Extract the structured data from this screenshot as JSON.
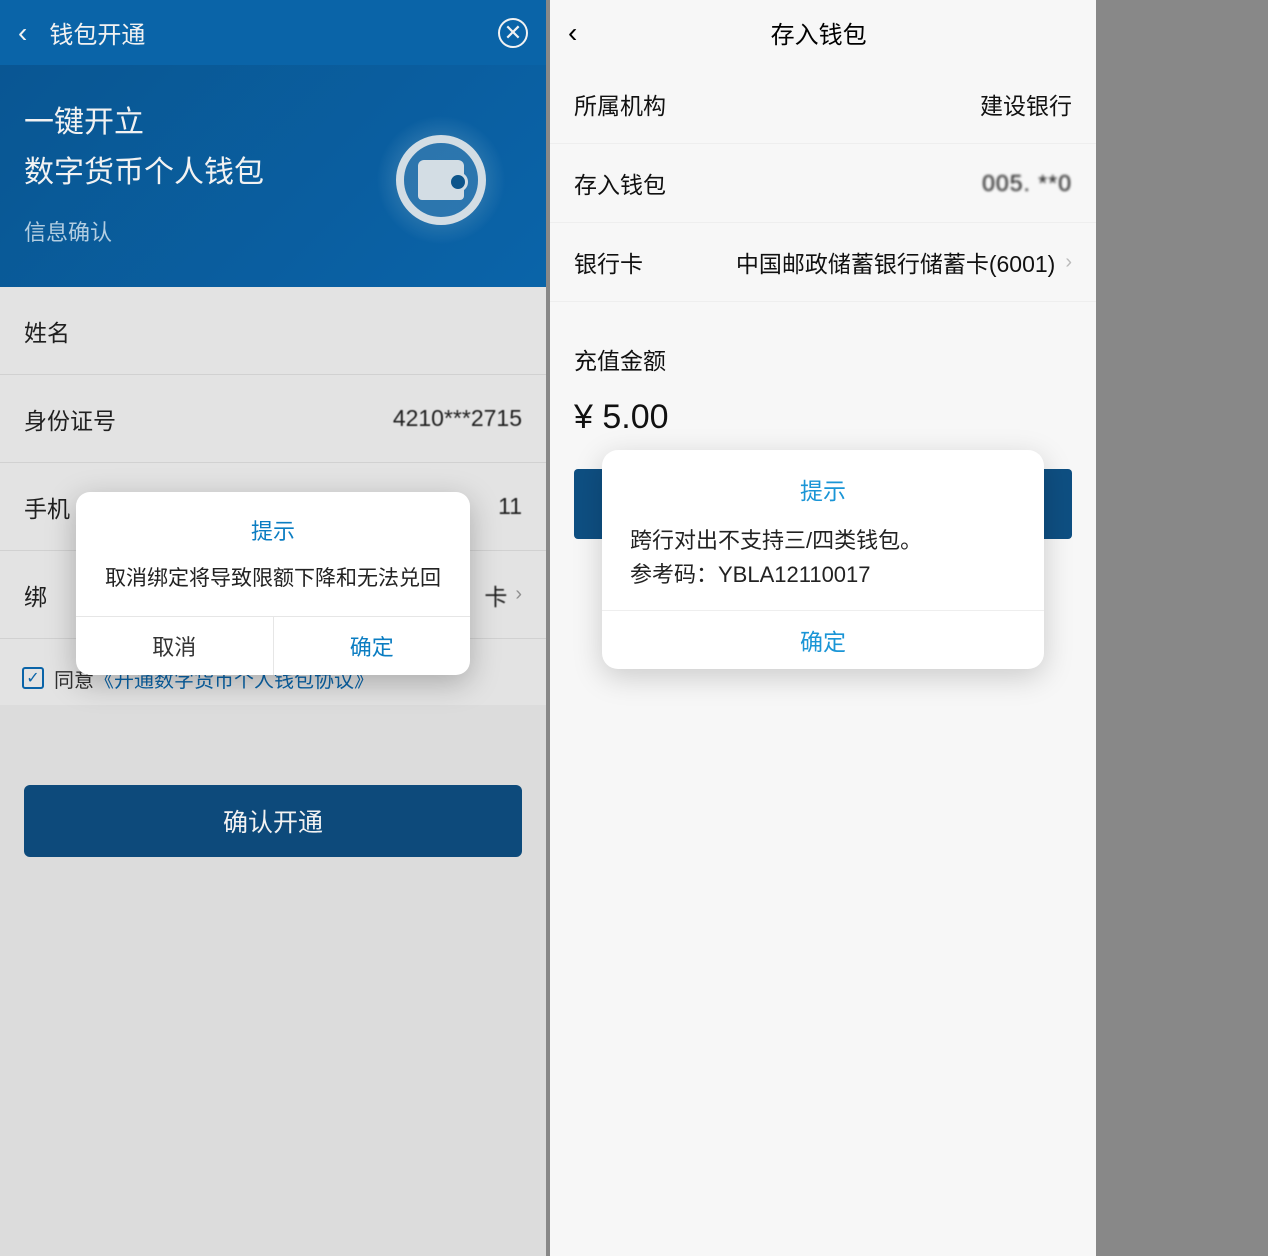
{
  "left": {
    "header": {
      "title": "钱包开通"
    },
    "hero": {
      "line1": "一键开立",
      "line2": "数字货币个人钱包",
      "line3": "信息确认"
    },
    "form": {
      "name_label": "姓名",
      "id_label": "身份证号",
      "id_value": "4210***2715",
      "phone_label": "手机",
      "phone_value": "11",
      "card_label": "绑",
      "card_value": "卡",
      "agree_text": "同意",
      "agreement_link": "《开通数字货币个人钱包协议》"
    },
    "confirm_button": "确认开通",
    "dialog": {
      "title": "提示",
      "body": "取消绑定将导致限额下降和无法兑回",
      "cancel": "取消",
      "ok": "确定"
    }
  },
  "right": {
    "header": {
      "title": "存入钱包"
    },
    "rows": {
      "org_label": "所属机构",
      "org_value": "建设银行",
      "wallet_label": "存入钱包",
      "wallet_value": "005. **0   ",
      "card_label": "银行卡",
      "card_value": "中国邮政储蓄银行储蓄卡(6001)"
    },
    "amount_label": "充值金额",
    "amount_value": "¥ 5.00",
    "dialog": {
      "title": "提示",
      "body_line1": "跨行对出不支持三/四类钱包。",
      "body_line2": "参考码：YBLA12110017",
      "ok": "确定"
    }
  }
}
